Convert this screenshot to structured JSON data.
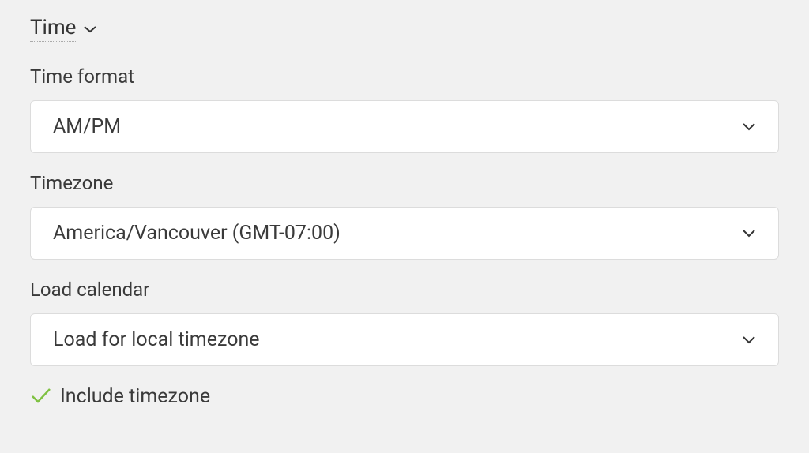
{
  "section": {
    "title": "Time"
  },
  "fields": {
    "time_format": {
      "label": "Time format",
      "value": "AM/PM"
    },
    "timezone": {
      "label": "Timezone",
      "value": "America/Vancouver (GMT-07:00)"
    },
    "load_calendar": {
      "label": "Load calendar",
      "value": "Load for local timezone"
    }
  },
  "checkbox": {
    "include_timezone": {
      "label": "Include timezone",
      "checked": true
    }
  }
}
